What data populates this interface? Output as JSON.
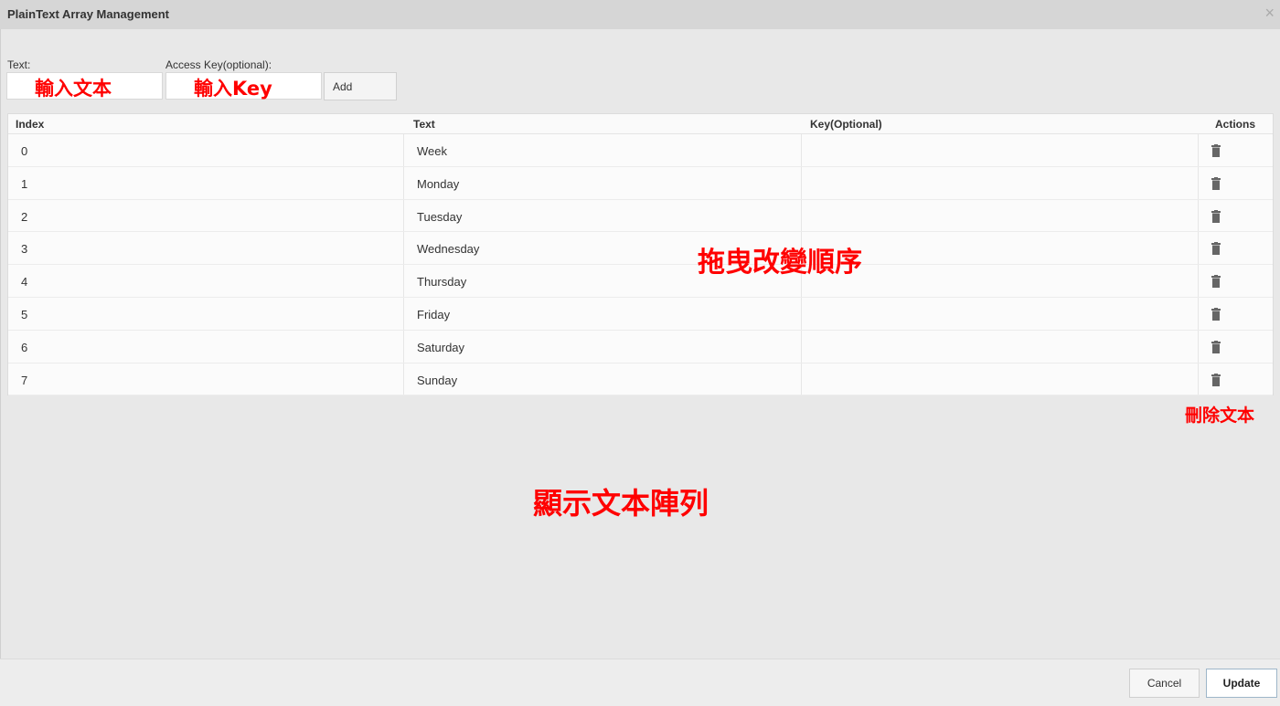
{
  "window": {
    "title": "PlainText Array Management",
    "close_glyph": "×"
  },
  "form": {
    "text_label": "Text:",
    "key_label": "Access Key(optional):",
    "add_label": "Add"
  },
  "annotations": {
    "text_input": "輸入文本",
    "key_input_prefix": "輸入",
    "key_input_suffix": "Key",
    "drag_reorder": "拖曳改變順序",
    "delete_text": "刪除文本",
    "display_array": "顯示文本陣列",
    "color": "#ff0000"
  },
  "table": {
    "headers": {
      "index": "Index",
      "text": "Text",
      "key": "Key(Optional)",
      "actions": "Actions"
    },
    "rows": [
      {
        "index": "0",
        "text": "Week",
        "key": ""
      },
      {
        "index": "1",
        "text": "Monday",
        "key": ""
      },
      {
        "index": "2",
        "text": "Tuesday",
        "key": ""
      },
      {
        "index": "3",
        "text": "Wednesday",
        "key": ""
      },
      {
        "index": "4",
        "text": "Thursday",
        "key": ""
      },
      {
        "index": "5",
        "text": "Friday",
        "key": ""
      },
      {
        "index": "6",
        "text": "Saturday",
        "key": ""
      },
      {
        "index": "7",
        "text": "Sunday",
        "key": ""
      }
    ],
    "action_icon": "trash-icon"
  },
  "footer": {
    "cancel_label": "Cancel",
    "update_label": "Update"
  }
}
